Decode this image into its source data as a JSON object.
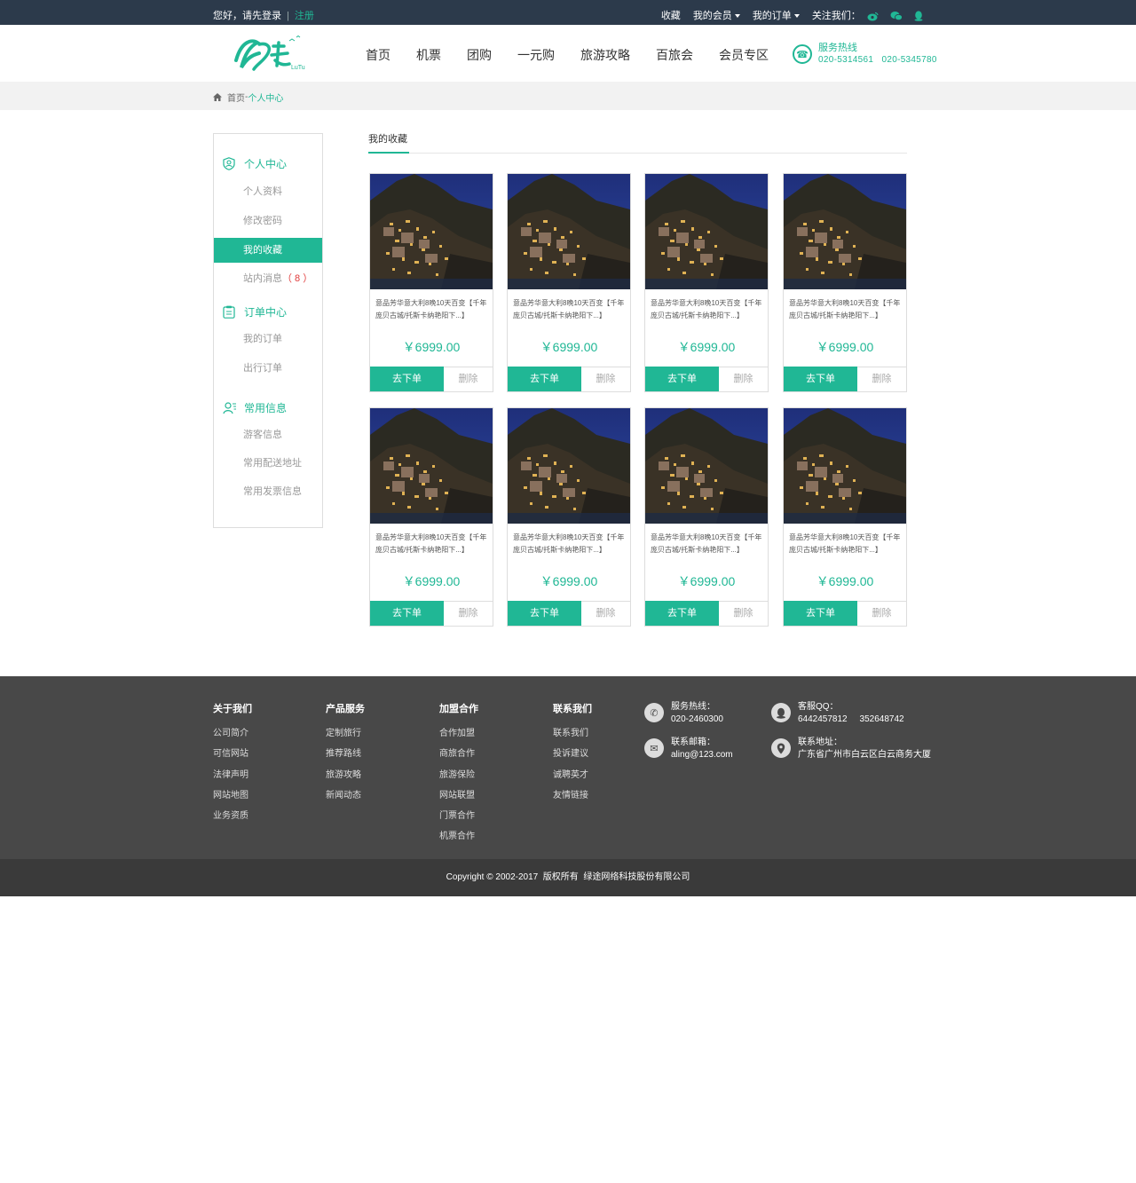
{
  "topbar": {
    "greeting": "您好，请先登录",
    "register": "注册",
    "links": [
      "收藏",
      "我的会员",
      "我的订单"
    ],
    "follow": "关注我们："
  },
  "nav": {
    "items": [
      "首页",
      "机票",
      "团购",
      "一元购",
      "旅游攻略",
      "百旅会",
      "会员专区"
    ]
  },
  "hotline": {
    "title": "服务热线",
    "numbers": "020-5314561   020-5345780"
  },
  "breadcrumb": {
    "home": "首页",
    "sep": "-",
    "current": "个人中心"
  },
  "sidebar": {
    "sec1": "个人中心",
    "sec1_items": [
      "个人资料",
      "修改密码",
      "我的收藏",
      "站内消息"
    ],
    "msg_count": "（ 8 ）",
    "sec2": "订单中心",
    "sec2_items": [
      "我的订单",
      "出行订单"
    ],
    "sec3": "常用信息",
    "sec3_items": [
      "游客信息",
      "常用配送地址",
      "常用发票信息"
    ]
  },
  "main": {
    "title": "我的收藏"
  },
  "products": [
    {
      "desc": "意品芳华意大利8晚10天百变【千年庞贝古城/托斯卡纳艳阳下...】",
      "price": "￥6999.00",
      "order": "去下单",
      "delete": "删除"
    },
    {
      "desc": "意品芳华意大利8晚10天百变【千年庞贝古城/托斯卡纳艳阳下...】",
      "price": "￥6999.00",
      "order": "去下单",
      "delete": "删除"
    },
    {
      "desc": "意品芳华意大利8晚10天百变【千年庞贝古城/托斯卡纳艳阳下...】",
      "price": "￥6999.00",
      "order": "去下单",
      "delete": "删除"
    },
    {
      "desc": "意品芳华意大利8晚10天百变【千年庞贝古城/托斯卡纳艳阳下...】",
      "price": "￥6999.00",
      "order": "去下单",
      "delete": "删除"
    },
    {
      "desc": "意品芳华意大利8晚10天百变【千年庞贝古城/托斯卡纳艳阳下...】",
      "price": "￥6999.00",
      "order": "去下单",
      "delete": "删除"
    },
    {
      "desc": "意品芳华意大利8晚10天百变【千年庞贝古城/托斯卡纳艳阳下...】",
      "price": "￥6999.00",
      "order": "去下单",
      "delete": "删除"
    },
    {
      "desc": "意品芳华意大利8晚10天百变【千年庞贝古城/托斯卡纳艳阳下...】",
      "price": "￥6999.00",
      "order": "去下单",
      "delete": "删除"
    },
    {
      "desc": "意品芳华意大利8晚10天百变【千年庞贝古城/托斯卡纳艳阳下...】",
      "price": "￥6999.00",
      "order": "去下单",
      "delete": "删除"
    }
  ],
  "footer": {
    "cols": [
      {
        "title": "关于我们",
        "items": [
          "公司简介",
          "可信网站",
          "法律声明",
          "网站地图",
          "业务资质"
        ]
      },
      {
        "title": "产品服务",
        "items": [
          "定制旅行",
          "推荐路线",
          "旅游攻略",
          "新闻动态"
        ]
      },
      {
        "title": "加盟合作",
        "items": [
          "合作加盟",
          "商旅合作",
          "旅游保险",
          "网站联盟",
          "门票合作",
          "机票合作"
        ]
      },
      {
        "title": "联系我们",
        "items": [
          "联系我们",
          "投诉建议",
          "诚聘英才",
          "友情链接"
        ]
      }
    ],
    "hotline_label": "服务热线：",
    "hotline": "020-2460300",
    "qq_label": "客服QQ：",
    "qq": "6442457812     352648742",
    "email_label": "联系邮箱：",
    "email": "aling@123.com",
    "address_label": "联系地址：",
    "address": "广东省广州市白云区白云商务大厦"
  },
  "copyright": "Copyright © 2002-2017  版权所有  绿途网络科技股份有限公司",
  "colors": {
    "accent": "#20b795",
    "topbar": "#2c3a4b",
    "footer": "#484848"
  }
}
